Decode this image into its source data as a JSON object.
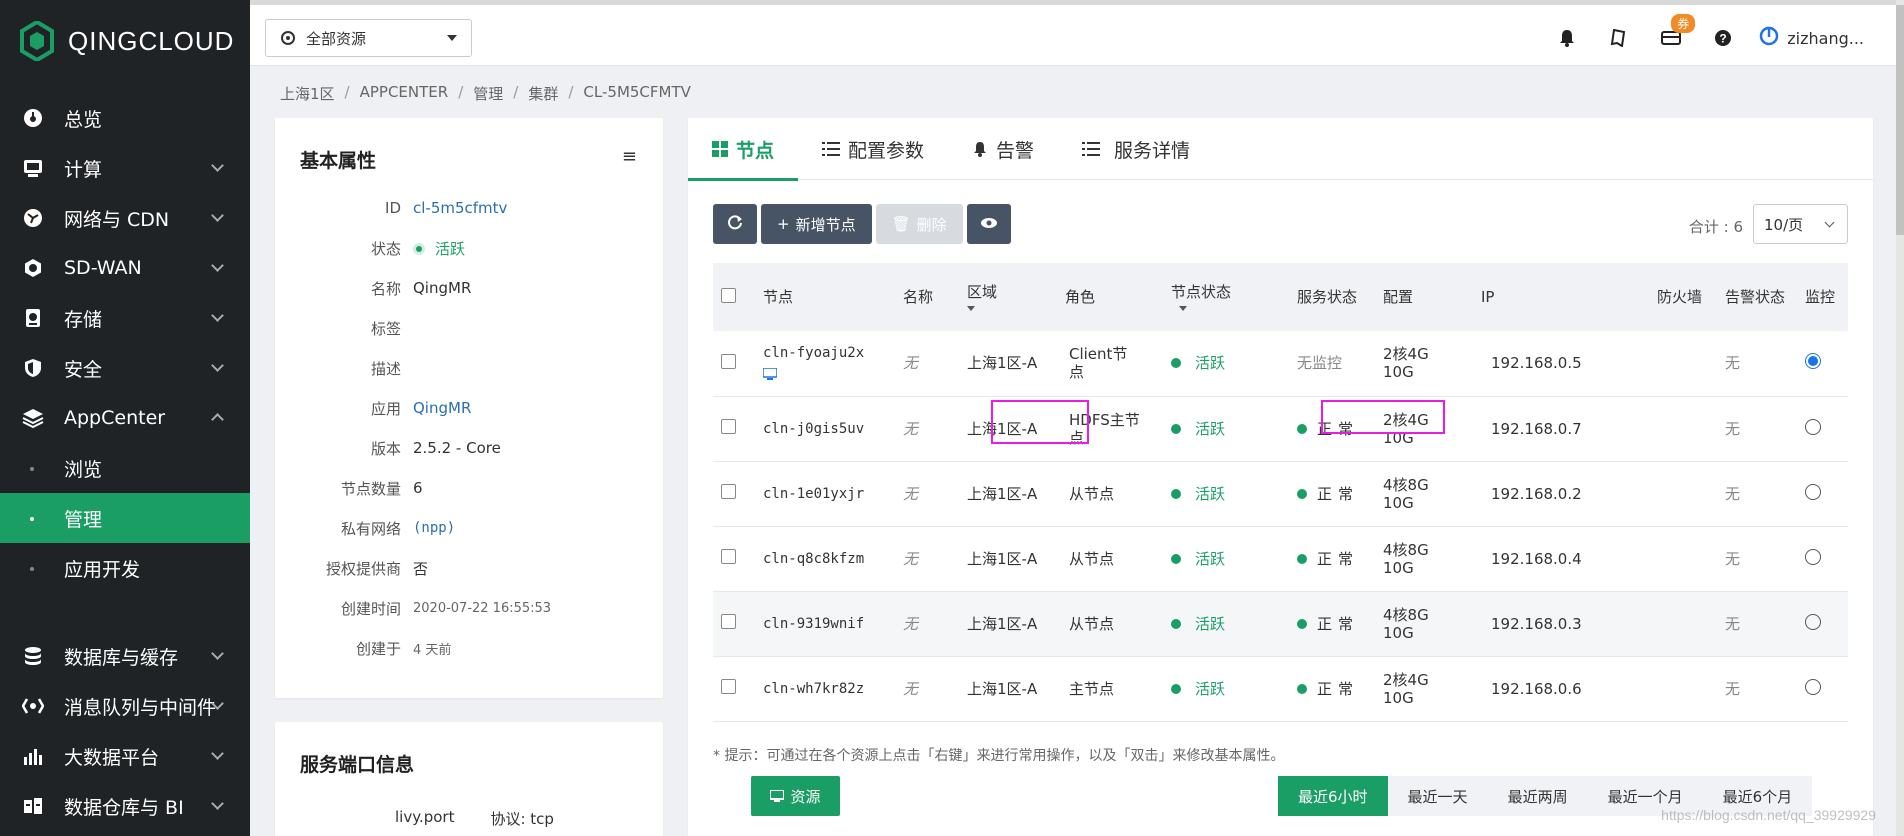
{
  "brand": {
    "name": "QINGCLOUD"
  },
  "sidebar": {
    "items": [
      {
        "label": "总览",
        "icon": "dashboard-icon",
        "chevron": false
      },
      {
        "label": "计算",
        "icon": "compute-icon",
        "chevron": true
      },
      {
        "label": "网络与 CDN",
        "icon": "network-icon",
        "chevron": true
      },
      {
        "label": "SD-WAN",
        "icon": "sdwan-icon",
        "chevron": true
      },
      {
        "label": "存储",
        "icon": "storage-icon",
        "chevron": true
      },
      {
        "label": "安全",
        "icon": "shield-icon",
        "chevron": true
      },
      {
        "label": "AppCenter",
        "icon": "appcenter-icon",
        "chevron": true,
        "expanded": true
      }
    ],
    "appcenter_sub": [
      {
        "label": "浏览",
        "active": false
      },
      {
        "label": "管理",
        "active": true
      },
      {
        "label": "应用开发",
        "active": false
      }
    ],
    "bottom_items": [
      {
        "label": "数据库与缓存",
        "icon": "database-icon"
      },
      {
        "label": "消息队列与中间件",
        "icon": "message-queue-icon"
      },
      {
        "label": "大数据平台",
        "icon": "bigdata-icon"
      },
      {
        "label": "数据仓库与 BI",
        "icon": "warehouse-icon"
      }
    ]
  },
  "topbar": {
    "resource_selector": "全部资源",
    "coupon_badge": "券",
    "username": "zizhang..."
  },
  "breadcrumb": [
    "上海1区",
    "APPCENTER",
    "管理",
    "集群",
    "CL-5M5CFMTV"
  ],
  "basic": {
    "title": "基本属性",
    "props": [
      {
        "key": "ID",
        "value": "cl-5m5cfmtv",
        "style": "link"
      },
      {
        "key": "状态",
        "value": "活跃",
        "style": "status"
      },
      {
        "key": "名称",
        "value": "QingMR",
        "style": ""
      },
      {
        "key": "标签",
        "value": "",
        "style": ""
      },
      {
        "key": "描述",
        "value": "",
        "style": ""
      },
      {
        "key": "应用",
        "value": "QingMR",
        "style": "link"
      },
      {
        "key": "版本",
        "value": "2.5.2 - Core",
        "style": ""
      },
      {
        "key": "节点数量",
        "value": "6",
        "style": ""
      },
      {
        "key": "私有网络",
        "value": "(npp)",
        "style": "link-mono"
      },
      {
        "key": "授权提供商",
        "value": "否",
        "style": ""
      },
      {
        "key": "创建时间",
        "value": "2020-07-22 16:55:53",
        "style": "small"
      },
      {
        "key": "创建于",
        "value": "4 天前",
        "style": "small"
      }
    ]
  },
  "ports": {
    "title": "服务端口信息",
    "name": "livy.port",
    "protocol": "协议: tcp"
  },
  "tabs": [
    {
      "label": "节点",
      "icon": "grid-icon",
      "active": true
    },
    {
      "label": "配置参数",
      "icon": "list-icon",
      "active": false
    },
    {
      "label": "告警",
      "icon": "bell-icon",
      "active": false
    },
    {
      "label": "服务详情",
      "icon": "list-icon",
      "active": false
    }
  ],
  "toolbar": {
    "add_label": "新增节点",
    "delete_label": "删除",
    "total": "合计 : 6",
    "page_size": "10/页"
  },
  "table": {
    "headers": {
      "node": "节点",
      "name": "名称",
      "zone": "区域",
      "role": "角色",
      "node_status": "节点状态",
      "service_status": "服务状态",
      "config": "配置",
      "ip": "IP",
      "firewall": "防火墙",
      "alarm_status": "告警状态",
      "monitor": "监控"
    },
    "rows": [
      {
        "id": "cln-fyoaju2x",
        "name": "无",
        "zone": "上海1区-A",
        "role": "Client节点",
        "status": "活跃",
        "service": "无监控",
        "service_ok": false,
        "config": "2核4G 10G",
        "ip": "192.168.0.5",
        "alarm": "无",
        "monitor": true,
        "has_vnc": true
      },
      {
        "id": "cln-j0gis5uv",
        "name": "无",
        "zone": "上海1区-A",
        "role": "HDFS主节点",
        "status": "活跃",
        "service": "正常",
        "service_ok": true,
        "config": "2核4G 10G",
        "ip": "192.168.0.7",
        "alarm": "无",
        "monitor": false,
        "has_vnc": false
      },
      {
        "id": "cln-1e01yxjr",
        "name": "无",
        "zone": "上海1区-A",
        "role": "从节点",
        "status": "活跃",
        "service": "正常",
        "service_ok": true,
        "config": "4核8G 10G",
        "ip": "192.168.0.2",
        "alarm": "无",
        "monitor": false,
        "has_vnc": false
      },
      {
        "id": "cln-q8c8kfzm",
        "name": "无",
        "zone": "上海1区-A",
        "role": "从节点",
        "status": "活跃",
        "service": "正常",
        "service_ok": true,
        "config": "4核8G 10G",
        "ip": "192.168.0.4",
        "alarm": "无",
        "monitor": false,
        "has_vnc": false
      },
      {
        "id": "cln-9319wnif",
        "name": "无",
        "zone": "上海1区-A",
        "role": "从节点",
        "status": "活跃",
        "service": "正常",
        "service_ok": true,
        "config": "4核8G 10G",
        "ip": "192.168.0.3",
        "alarm": "无",
        "monitor": false,
        "has_vnc": false
      },
      {
        "id": "cln-wh7kr82z",
        "name": "无",
        "zone": "上海1区-A",
        "role": "主节点",
        "status": "活跃",
        "service": "正常",
        "service_ok": true,
        "config": "2核4G 10G",
        "ip": "192.168.0.6",
        "alarm": "无",
        "monitor": false,
        "has_vnc": false
      }
    ]
  },
  "hint": "* 提示：可通过在各个资源上点击「右键」来进行常用操作，以及「双击」来修改基本属性。",
  "resource_button": "资源",
  "ranges": [
    {
      "label": "最近6小时",
      "active": true
    },
    {
      "label": "最近一天",
      "active": false
    },
    {
      "label": "最近两周",
      "active": false
    },
    {
      "label": "最近一个月",
      "active": false
    },
    {
      "label": "最近6个月",
      "active": false
    }
  ],
  "watermark": "https://blog.csdn.net/qq_39929929",
  "colors": {
    "accent": "#1a9e66",
    "sidebar": "#1f2326",
    "highlight": "#e81ce8",
    "button_dark": "#475466"
  }
}
